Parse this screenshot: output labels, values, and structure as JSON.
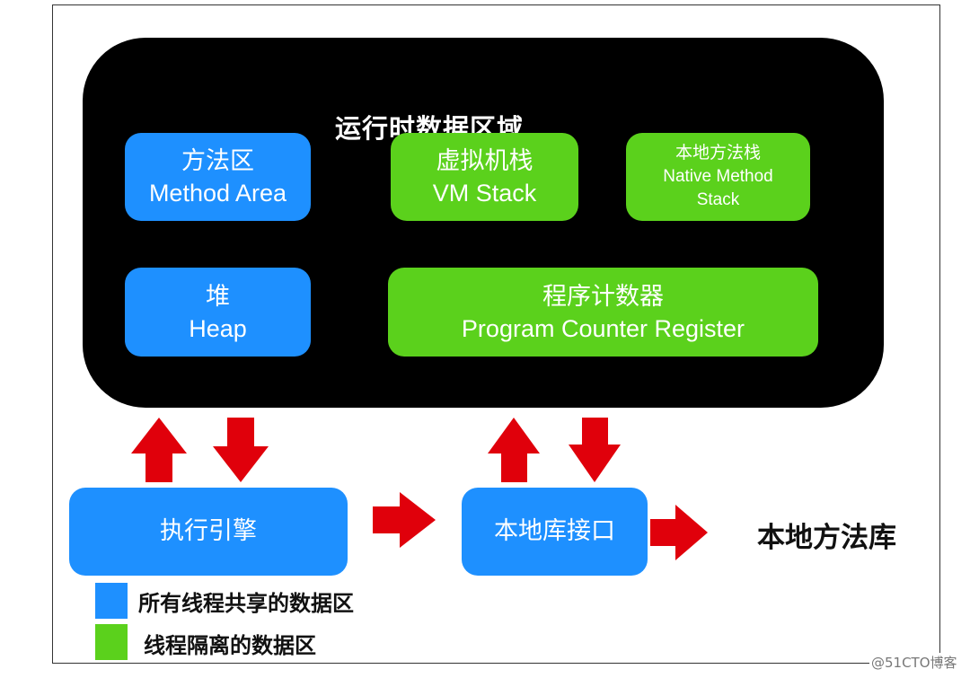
{
  "runtime_area": {
    "title": "运行时数据区域"
  },
  "areas": {
    "method_area": {
      "zh": "方法区",
      "en": "Method Area",
      "color": "#1e90ff"
    },
    "vm_stack": {
      "zh": "虚拟机栈",
      "en": "VM Stack",
      "color": "#5bd11c"
    },
    "native_method_stack": {
      "zh": "本地方法栈",
      "en1": "Native Method",
      "en2": "Stack",
      "color": "#5bd11c"
    },
    "heap": {
      "zh": "堆",
      "en": "Heap",
      "color": "#1e90ff"
    },
    "pc_register": {
      "zh": "程序计数器",
      "en": "Program Counter Register",
      "color": "#5bd11c"
    }
  },
  "execution_engine": {
    "label": "执行引擎"
  },
  "native_interface": {
    "label": "本地库接口"
  },
  "native_library": {
    "label": "本地方法库"
  },
  "arrow_color": "#e0000b",
  "legend": [
    {
      "color": "#1e90ff",
      "label": "所有线程共享的数据区"
    },
    {
      "color": "#5bd11c",
      "label": "线程隔离的数据区"
    }
  ],
  "watermark": "@51CTO博客"
}
